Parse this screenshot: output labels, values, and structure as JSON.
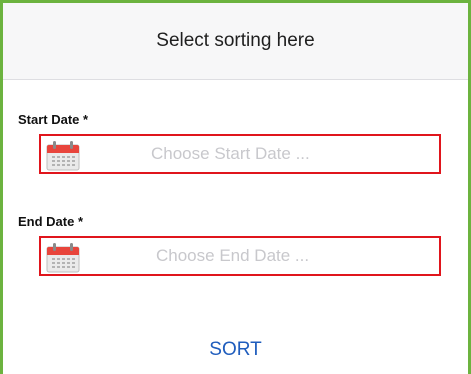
{
  "header": {
    "title": "Select sorting here"
  },
  "start_date": {
    "label": "Start Date *",
    "placeholder": "Choose Start Date ...",
    "icon": "calendar-icon"
  },
  "end_date": {
    "label": "End Date *",
    "placeholder": "Choose End Date ...",
    "icon": "calendar-icon"
  },
  "actions": {
    "sort_label": "SORT"
  },
  "colors": {
    "frame_border": "#6cb33f",
    "field_border": "#e0151c",
    "accent": "#1f5dbd",
    "calendar_red": "#e8453c"
  }
}
